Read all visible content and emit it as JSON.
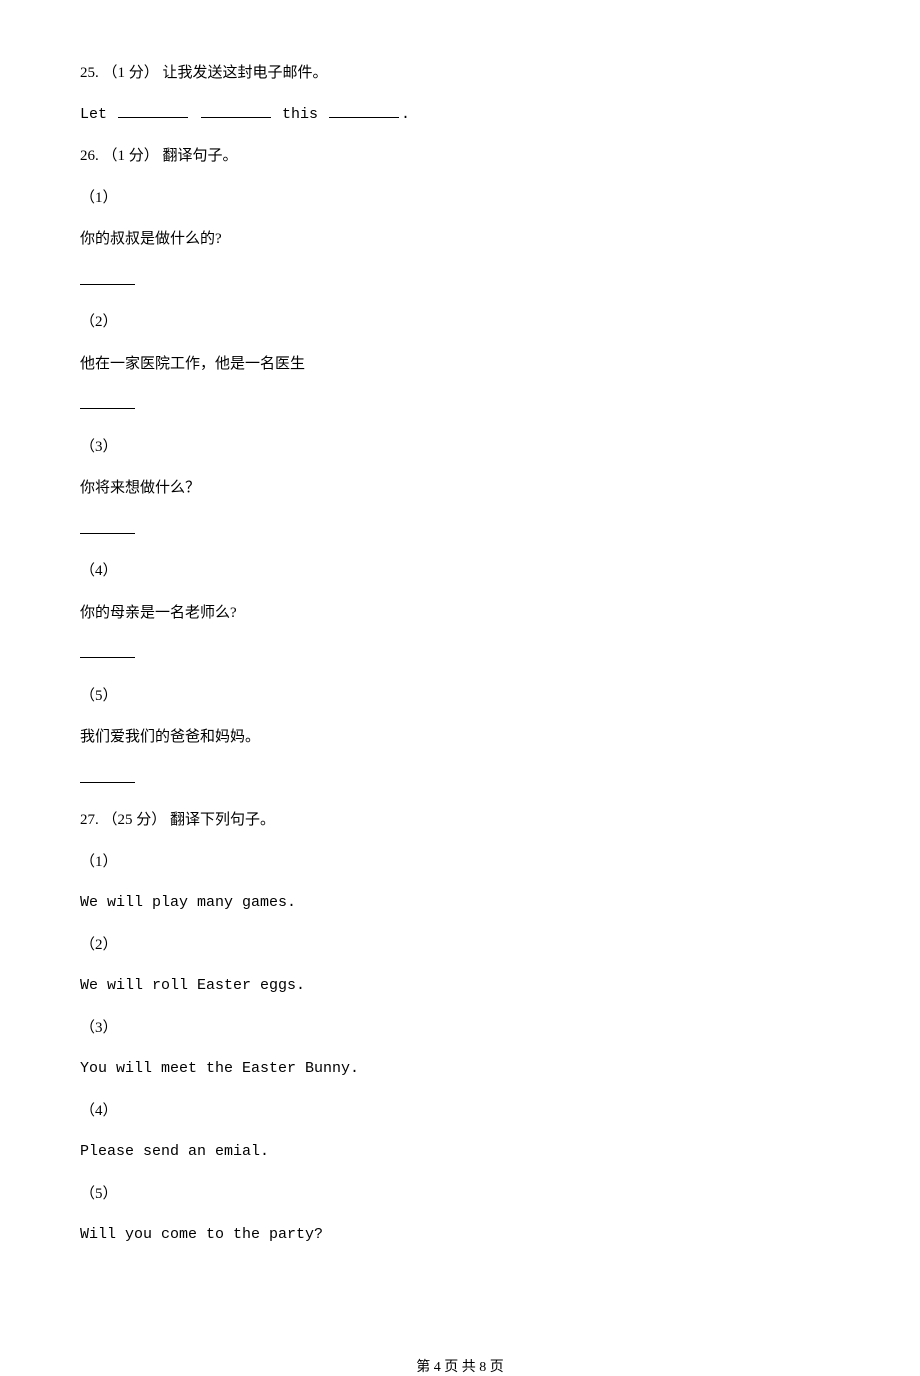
{
  "q25": {
    "header": "25. （1 分）  让我发送这封电子邮件。",
    "line_prefix": "Let ",
    "line_mid": " this ",
    "line_end": "."
  },
  "q26": {
    "header": "26. （1 分）  翻译句子。",
    "items": [
      {
        "num": "（1）",
        "text": "你的叔叔是做什么的?"
      },
      {
        "num": "（2）",
        "text": "他在一家医院工作，他是一名医生"
      },
      {
        "num": "（3）",
        "text": "你将来想做什么？"
      },
      {
        "num": "（4）",
        "text": "你的母亲是一名老师么?"
      },
      {
        "num": "（5）",
        "text": "我们爱我们的爸爸和妈妈。"
      }
    ]
  },
  "q27": {
    "header": "27. （25 分）  翻译下列句子。",
    "items": [
      {
        "num": "（1）",
        "text": "We will play many games."
      },
      {
        "num": "（2）",
        "text": "We will roll Easter eggs."
      },
      {
        "num": "（3）",
        "text": "You will meet the Easter Bunny."
      },
      {
        "num": "（4）",
        "text": "Please send an emial."
      },
      {
        "num": "（5）",
        "text": "Will you come to the party?"
      }
    ]
  },
  "footer": "第 4 页 共 8 页"
}
